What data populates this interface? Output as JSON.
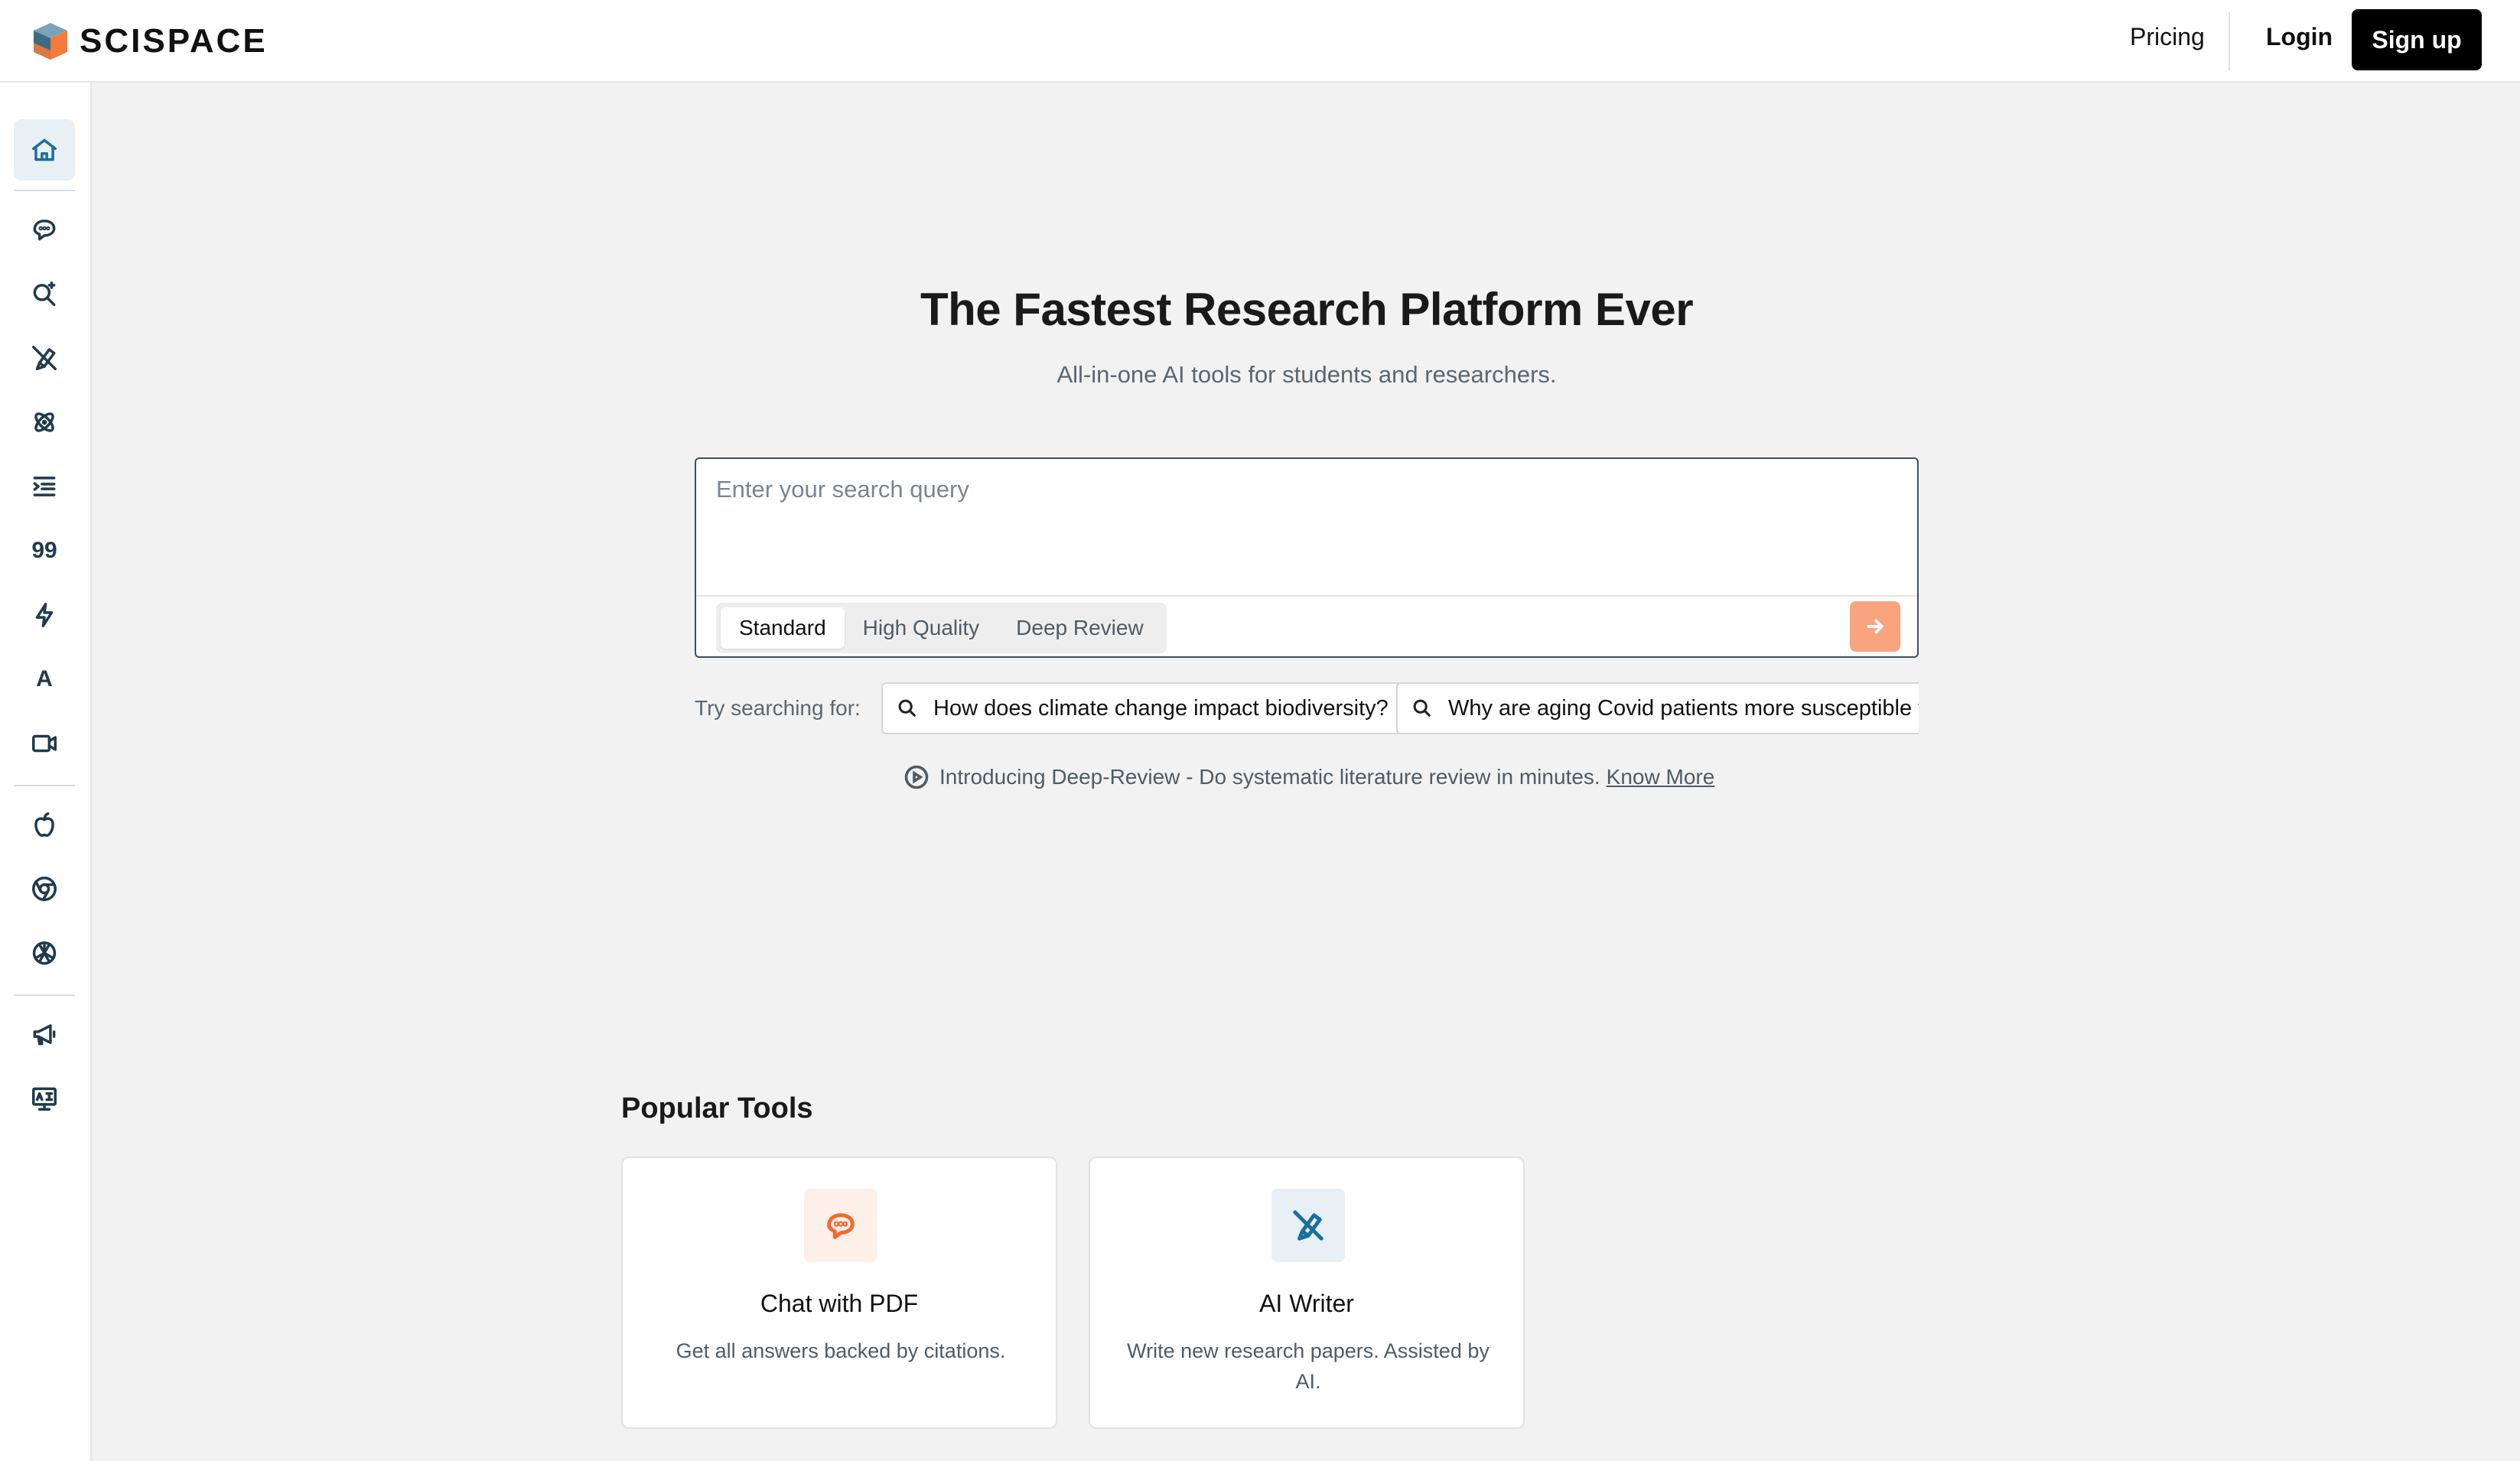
{
  "brand": {
    "name": "SCISPACE"
  },
  "nav": {
    "pricing": "Pricing",
    "login": "Login",
    "signup": "Sign up"
  },
  "sidebar": {
    "items": [
      {
        "icon": "home-icon",
        "active": true
      },
      {
        "icon": "chat-icon"
      },
      {
        "icon": "search-ai-icon"
      },
      {
        "icon": "pen-icon"
      },
      {
        "icon": "atom-icon"
      },
      {
        "icon": "list-indent-icon"
      },
      {
        "icon": "quote-icon",
        "glyph": "99"
      },
      {
        "icon": "bolt-icon"
      },
      {
        "icon": "ai-detector-icon",
        "glyph": "A"
      },
      {
        "icon": "video-icon"
      },
      {
        "icon": "apple-icon"
      },
      {
        "icon": "chrome-icon"
      },
      {
        "icon": "openai-icon"
      },
      {
        "icon": "megaphone-icon"
      },
      {
        "icon": "presentation-icon"
      }
    ]
  },
  "hero": {
    "title": "The Fastest Research Platform Ever",
    "subtitle": "All-in-one AI tools for students and researchers."
  },
  "search": {
    "placeholder": "Enter your search query",
    "value": "",
    "modes": [
      "Standard",
      "High Quality",
      "Deep Review"
    ],
    "selected_mode": "Standard"
  },
  "suggestions": {
    "label": "Try searching for:",
    "items": [
      "How does climate change impact biodiversity?",
      "Why are aging Covid patients more susceptible to"
    ]
  },
  "announcement": {
    "text": "Introducing Deep-Review - Do systematic literature review in minutes.",
    "link": "Know More"
  },
  "popular": {
    "title": "Popular Tools",
    "tools": [
      {
        "name": "Chat with PDF",
        "description": "Get all answers backed by citations.",
        "icon": "chat-icon",
        "color": "#f26b2b",
        "bg": "#fdf0e9"
      },
      {
        "name": "AI Writer",
        "description": "Write new research papers. Assisted by AI.",
        "icon": "pen-icon",
        "color": "#1b6fa0",
        "bg": "#e8f0f5"
      }
    ]
  }
}
